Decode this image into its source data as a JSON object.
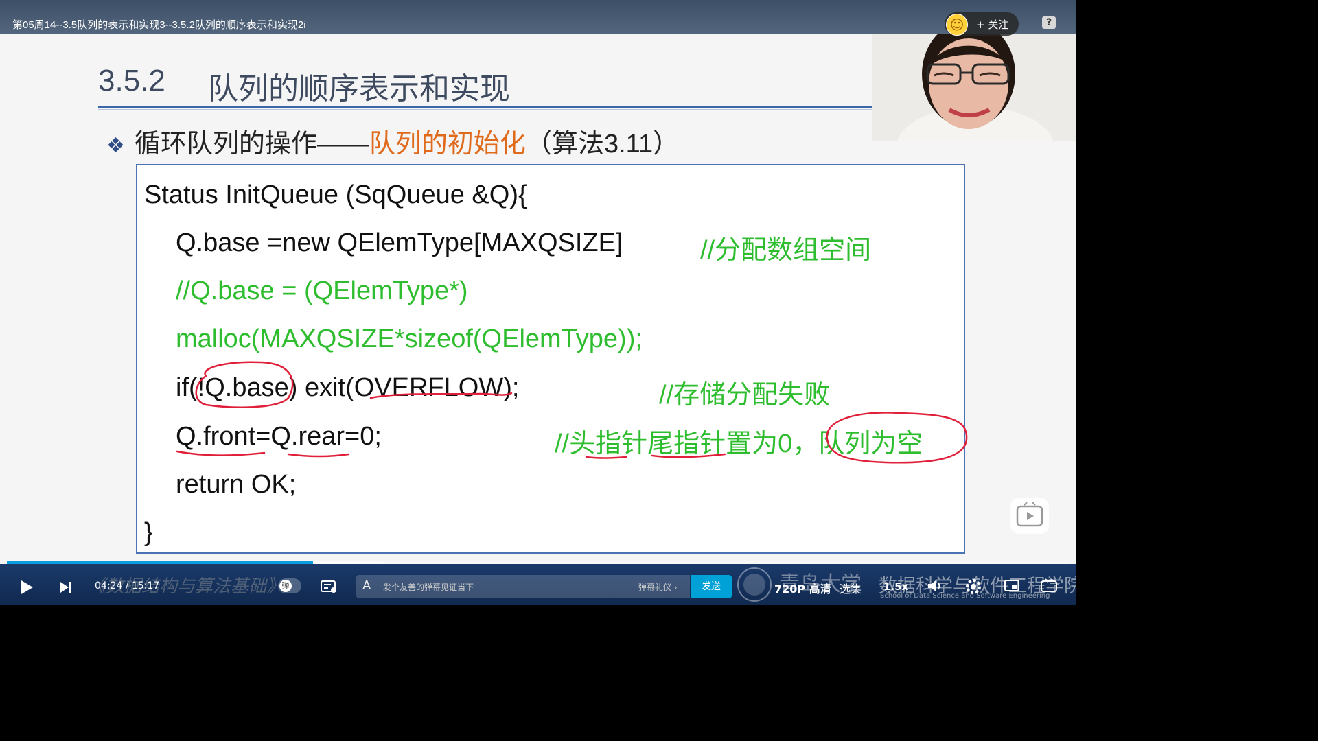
{
  "header": {
    "title": "第05周14--3.5队列的表示和实现3--3.5.2队列的顺序表示和实现2i",
    "follow_label": "+ 关注",
    "help_label": "?"
  },
  "slide": {
    "section_number": "3.5.2",
    "heading": "队列的顺序表示和实现",
    "bullet_prefix": "循环队列的操作——",
    "bullet_highlight": "队列的初始化",
    "bullet_suffix": "（算法3.11）",
    "code": {
      "line1": "Status InitQueue (SqQueue &Q){",
      "line2": "Q.base =new QElemType[MAXQSIZE]",
      "line2_comment": "//分配数组空间",
      "line3": "//Q.base = (QElemType*)",
      "line4": "malloc(MAXQSIZE*sizeof(QElemType));",
      "line5": "if(!Q.base) exit(OVERFLOW);",
      "line5_comment": "//存储分配失败",
      "line6": "Q.front=Q.rear=0;",
      "line6_comment": "//头指针尾指针置为0，队列为空",
      "line7": "return OK;",
      "line8": "}"
    },
    "colors": {
      "title": "#3e4a60",
      "highlight": "#e06a1c",
      "comment": "#2ebd2e",
      "annotation": "#e0203a"
    }
  },
  "controls": {
    "time": "04:24 / 15:17",
    "progress": 0.288,
    "danmaku_toggle_label": "弹",
    "danmaku_placeholder": "发个友善的弹幕见证当下",
    "danmaku_rules": "弹幕礼仪 ›",
    "send_label": "发送",
    "quality_label": "720P 高清",
    "episodes_label": "选集",
    "speed_label": "1.5x"
  },
  "branding": {
    "course_watermark": "《数据结构与算法基础》",
    "university": "青岛大学",
    "school": "数据科学与软件工程学院",
    "school_en": "School of Data Science and Software Engineering"
  }
}
